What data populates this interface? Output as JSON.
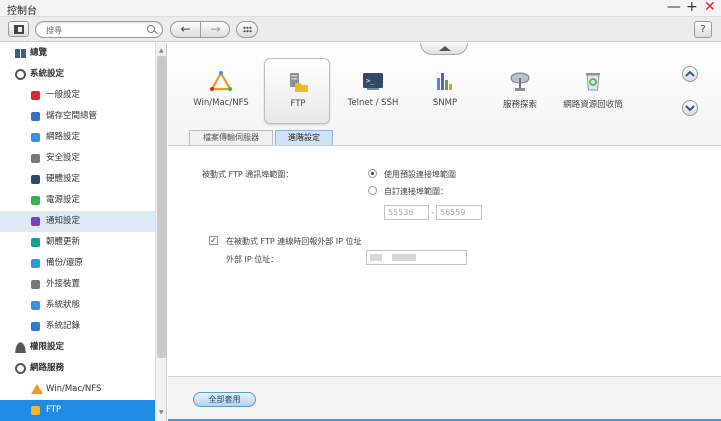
{
  "window": {
    "title": "控制台",
    "min_glyph": "—",
    "max_glyph": "+",
    "close_glyph": "✕"
  },
  "toolbar": {
    "search_placeholder": "搜尋",
    "back_glyph": "←",
    "forward_glyph": "→",
    "help_label": "?"
  },
  "sidebar": {
    "items": [
      {
        "label": "總覽",
        "level": "top",
        "icon": "overview-icon"
      },
      {
        "label": "系統設定",
        "level": "top",
        "icon": "gear-icon"
      },
      {
        "label": "一般設定",
        "level": "sub",
        "icon": "general-settings-icon"
      },
      {
        "label": "儲存空間總管",
        "level": "sub",
        "icon": "storage-icon"
      },
      {
        "label": "網路設定",
        "level": "sub",
        "icon": "network-icon"
      },
      {
        "label": "安全設定",
        "level": "sub",
        "icon": "lock-icon"
      },
      {
        "label": "硬體設定",
        "level": "sub",
        "icon": "hardware-icon"
      },
      {
        "label": "電源設定",
        "level": "sub",
        "icon": "power-icon"
      },
      {
        "label": "通知設定",
        "level": "sub",
        "icon": "notification-icon",
        "state": "selected"
      },
      {
        "label": "韌體更新",
        "level": "sub",
        "icon": "firmware-icon"
      },
      {
        "label": "備份/還原",
        "level": "sub",
        "icon": "backup-icon"
      },
      {
        "label": "外接裝置",
        "level": "sub",
        "icon": "external-device-icon"
      },
      {
        "label": "系統狀態",
        "level": "sub",
        "icon": "system-status-icon"
      },
      {
        "label": "系統記錄",
        "level": "sub",
        "icon": "system-log-icon"
      },
      {
        "label": "權限設定",
        "level": "top",
        "icon": "user-icon"
      },
      {
        "label": "網路服務",
        "level": "top",
        "icon": "network-services-icon"
      },
      {
        "label": "Win/Mac/NFS",
        "level": "sub",
        "icon": "win-mac-nfs-icon"
      },
      {
        "label": "FTP",
        "level": "sub",
        "icon": "ftp-icon",
        "state": "active"
      }
    ]
  },
  "apps": [
    {
      "label": "Win/Mac/NFS",
      "icon": "win-mac-nfs-icon"
    },
    {
      "label": "FTP",
      "icon": "ftp-server-icon",
      "selected": true
    },
    {
      "label": "Telnet / SSH",
      "icon": "terminal-icon"
    },
    {
      "label": "SNMP",
      "icon": "snmp-chart-icon"
    },
    {
      "label": "服務探索",
      "icon": "satellite-dish-icon"
    },
    {
      "label": "網路資源回收筒",
      "icon": "recycle-bin-icon"
    }
  ],
  "tabs": [
    {
      "label": "檔案傳輸伺服器",
      "active": false
    },
    {
      "label": "進階設定",
      "active": true
    }
  ],
  "form": {
    "passive_range_label": "被動式 FTP 通訊埠範圍：",
    "option_default": "使用預設連接埠範圍",
    "option_custom": "自訂連接埠範圍：",
    "port_start": "55536",
    "port_end": "56559",
    "port_separator": "-",
    "external_ip_checkbox_label": "在被動式 FTP 連線時回報外部 IP 位址",
    "external_ip_label": "外部 IP 位址："
  },
  "footer": {
    "apply_label": "全部套用"
  },
  "colors": {
    "accent": "#1f8be4",
    "selected_row": "#dde9f5",
    "close": "#e0242b"
  }
}
